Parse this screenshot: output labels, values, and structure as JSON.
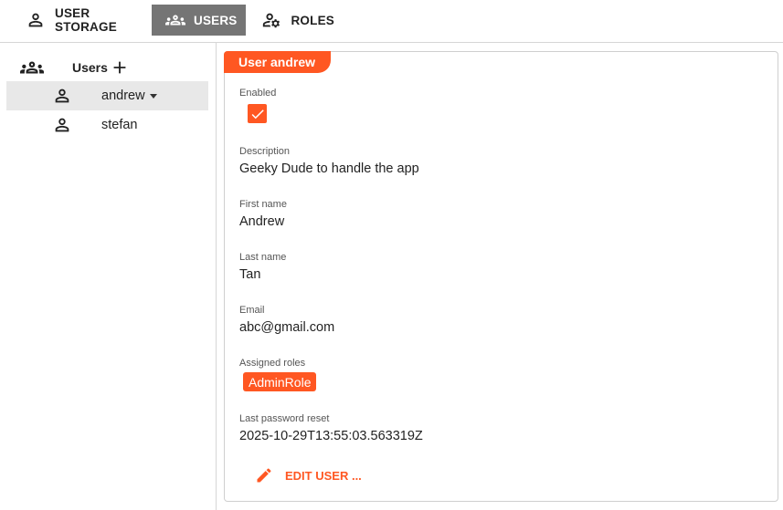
{
  "tabs": [
    {
      "label": "USER STORAGE",
      "icon": "person-outline-icon",
      "active": false
    },
    {
      "label": "USERS",
      "icon": "group-icon",
      "active": true
    },
    {
      "label": "ROLES",
      "icon": "manage-accounts-icon",
      "active": false
    }
  ],
  "sidebar": {
    "title": "Users",
    "users": [
      {
        "name": "andrew",
        "selected": true
      },
      {
        "name": "stefan",
        "selected": false
      }
    ]
  },
  "detail": {
    "badge": "User andrew",
    "enabled_label": "Enabled",
    "enabled": true,
    "description_label": "Description",
    "description": "Geeky Dude to handle the app",
    "first_name_label": "First name",
    "first_name": "Andrew",
    "last_name_label": "Last name",
    "last_name": "Tan",
    "email_label": "Email",
    "email": "abc@gmail.com",
    "roles_label": "Assigned roles",
    "roles": [
      "AdminRole"
    ],
    "password_reset_label": "Last password reset",
    "password_reset": "2025-10-29T13:55:03.563319Z",
    "edit_label": "EDIT USER ..."
  },
  "colors": {
    "accent": "#ff5722",
    "active_tab": "#757575",
    "selected_row": "#e8e8e8"
  }
}
